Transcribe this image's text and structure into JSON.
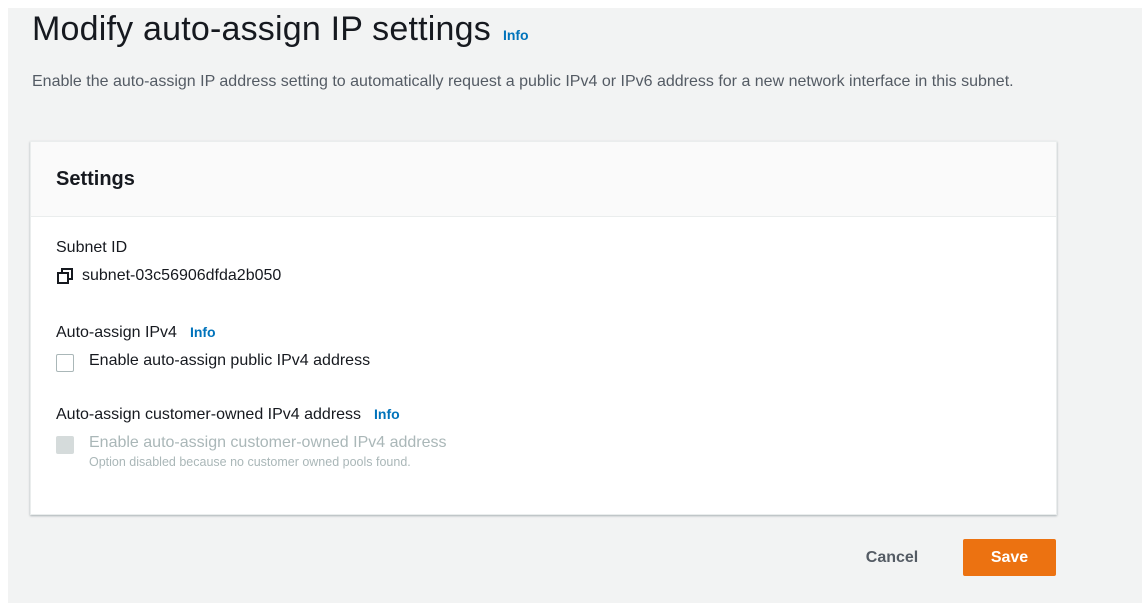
{
  "header": {
    "title": "Modify auto-assign IP settings",
    "info": "Info",
    "description": "Enable the auto-assign IP address setting to automatically request a public IPv4 or IPv6 address for a new network interface in this subnet."
  },
  "settings": {
    "title": "Settings",
    "subnet_label": "Subnet ID",
    "subnet_id": "subnet-03c56906dfda2b050",
    "ipv4": {
      "label": "Auto-assign IPv4",
      "info": "Info",
      "checkbox_label": "Enable auto-assign public IPv4 address",
      "checked": false
    },
    "customer_owned": {
      "label": "Auto-assign customer-owned IPv4 address",
      "info": "Info",
      "checkbox_label": "Enable auto-assign customer-owned IPv4 address",
      "hint": "Option disabled because no customer owned pools found.",
      "disabled": true
    }
  },
  "actions": {
    "cancel": "Cancel",
    "save": "Save"
  },
  "colors": {
    "primary": "#ec7211",
    "link": "#0073bb",
    "background": "#f2f3f3"
  }
}
